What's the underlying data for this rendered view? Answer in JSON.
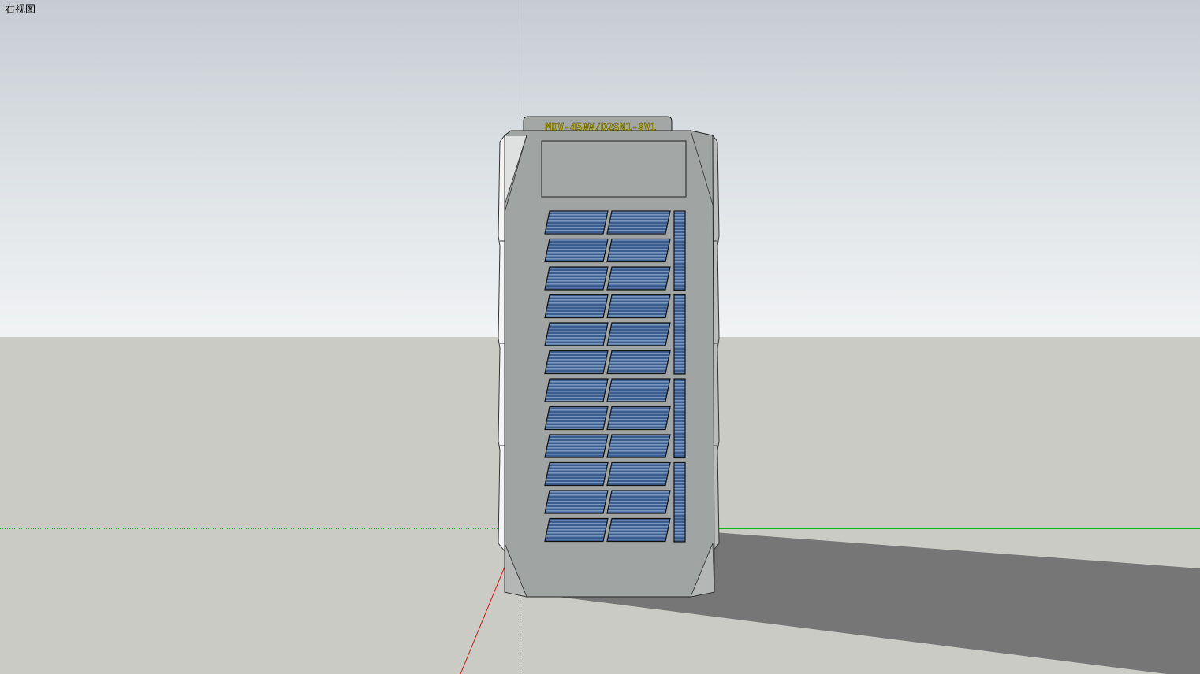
{
  "viewport": {
    "view_label": "右视图"
  },
  "model": {
    "nameplate_text": "MDV-450W/D2SN1-8V1",
    "colors": {
      "sky_top": "#c6ccd2",
      "sky_horizon": "#f1f3f4",
      "ground": "#cbcbc5",
      "shadow": "#767676",
      "body": "#a0a4a2",
      "body_light": "#f4f5f4",
      "louver": "#3c5f8f",
      "louver_stripe": "#6f8fb8",
      "nameplate_text": "#c8b400",
      "axis_blue": "#1a2bd6",
      "axis_green": "#16b416",
      "axis_red": "#d41a1a"
    }
  }
}
